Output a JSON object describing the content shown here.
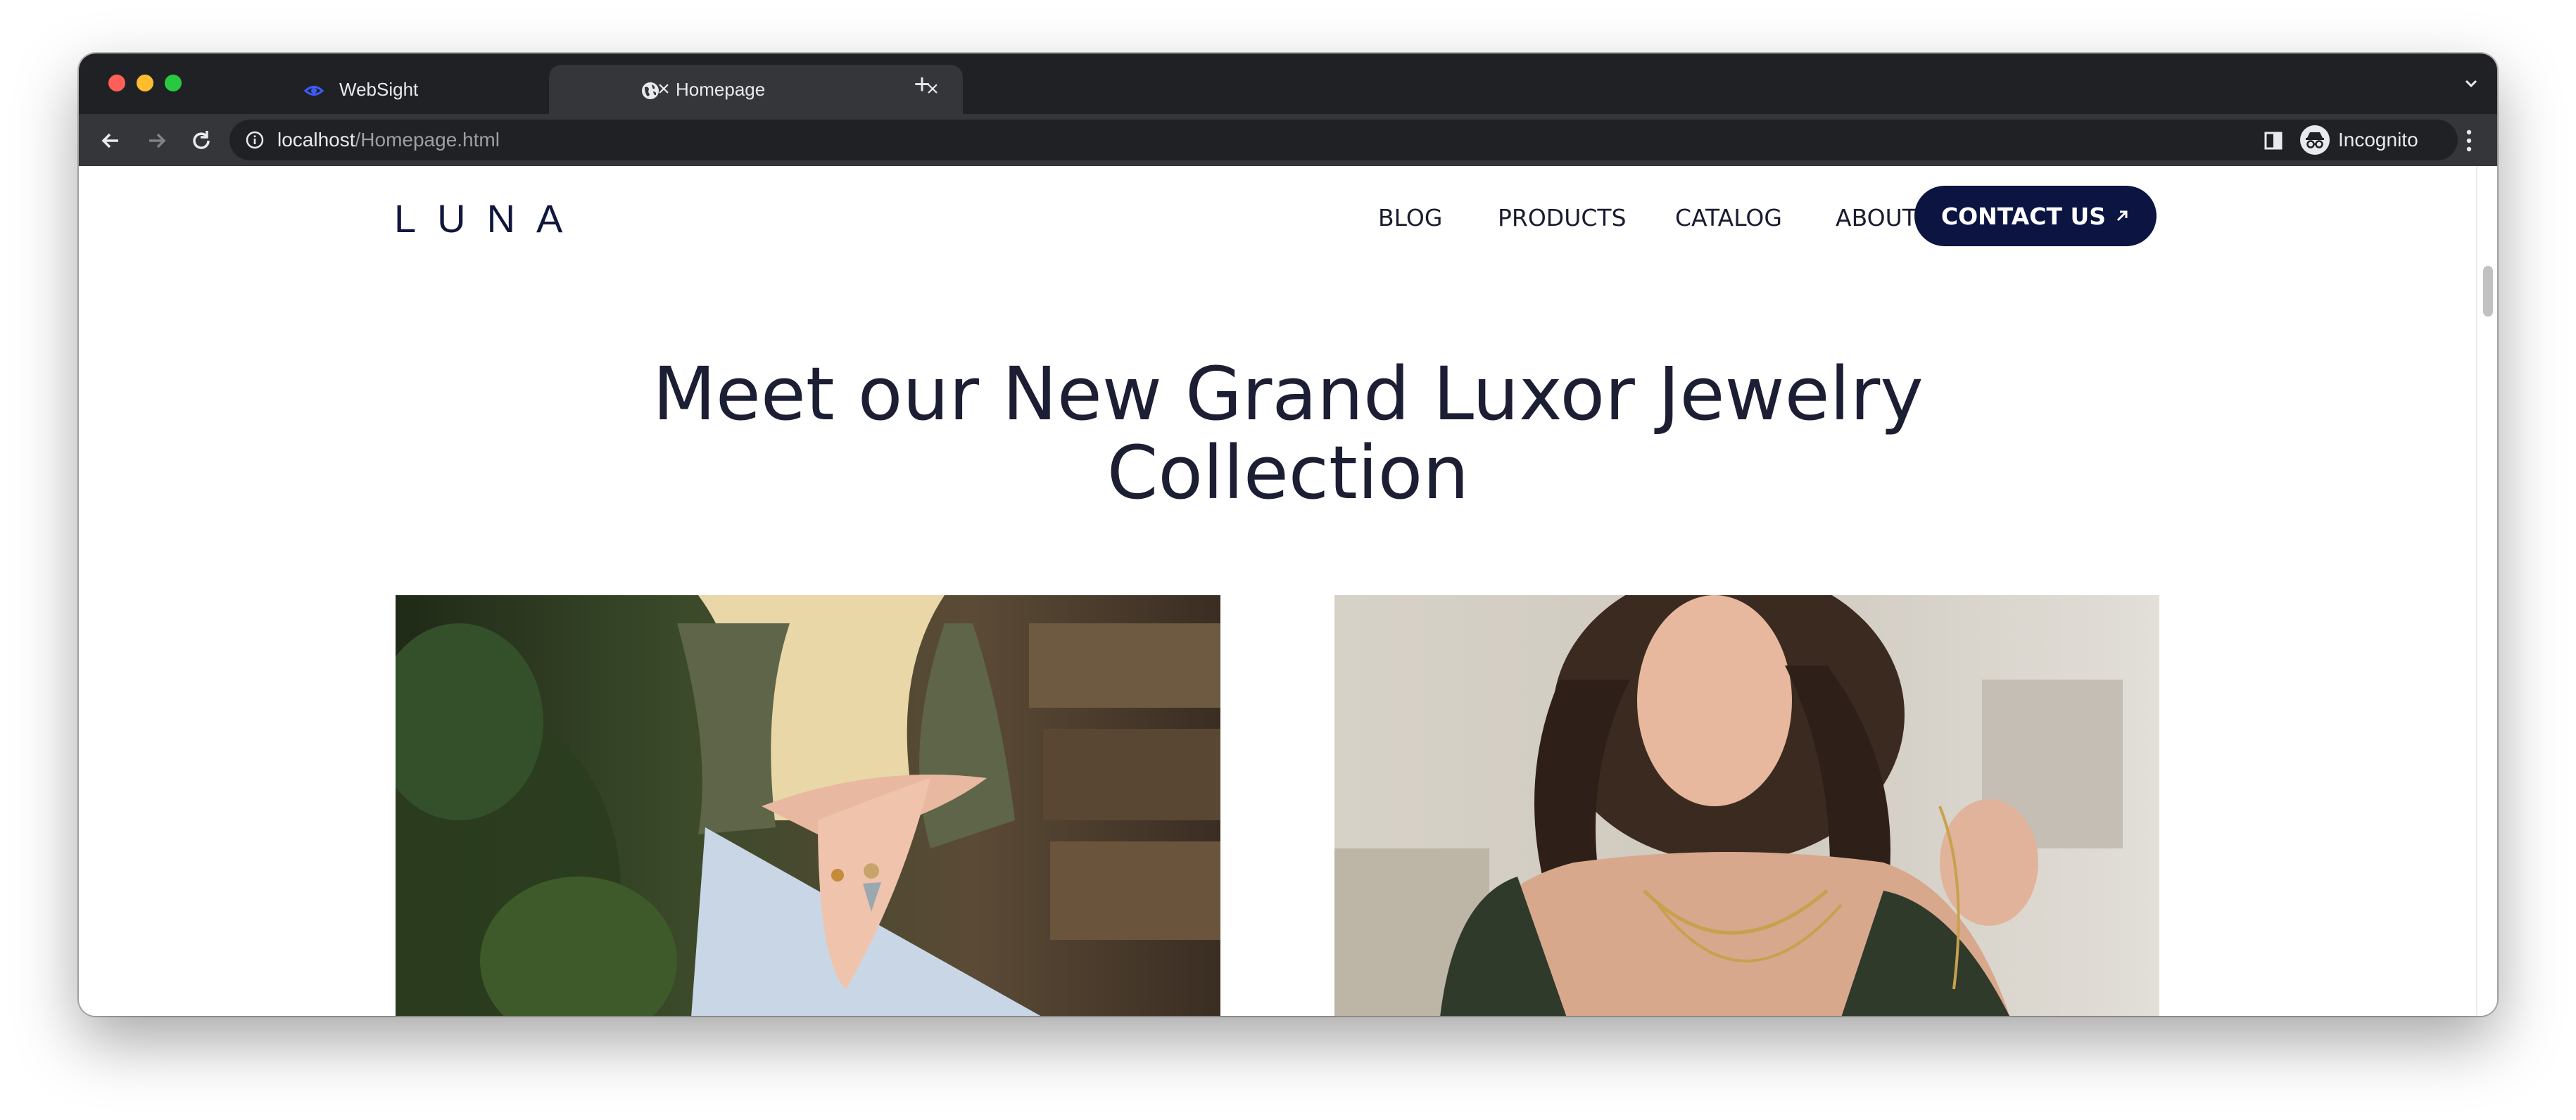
{
  "browser": {
    "tabs": [
      {
        "title": "WebSight",
        "icon": "websight-eye-icon"
      },
      {
        "title": "Homepage",
        "icon": "globe-icon",
        "active": true
      }
    ],
    "url_host": "localhost",
    "url_path": "/Homepage.html",
    "profile_label": "Incognito"
  },
  "site": {
    "logo": "LUNA",
    "nav": [
      "BLOG",
      "PRODUCTS",
      "CATALOG",
      "ABOUT"
    ],
    "cta_label": "CONTACT US",
    "hero_title_line1": "Meet our New Grand Luxor Jewelry",
    "hero_title_line2": "Collection"
  },
  "colors": {
    "brand_navy": "#0c1442",
    "title": "#1c1e33",
    "chrome_dark": "#202124",
    "chrome_toolbar": "#35363a"
  }
}
